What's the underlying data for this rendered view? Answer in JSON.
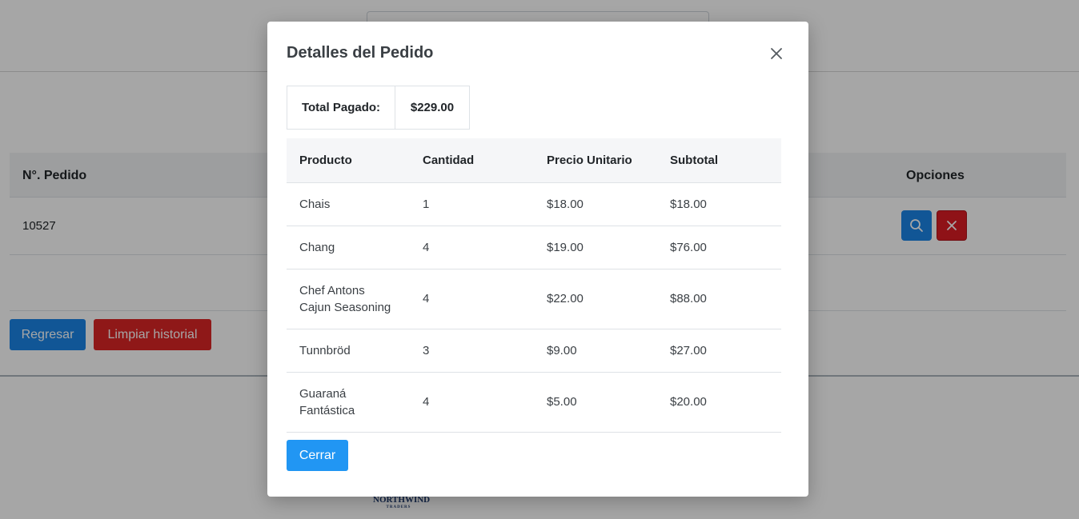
{
  "background": {
    "table": {
      "headers": {
        "order_no": "N°. Pedido",
        "options": "Opciones"
      },
      "rows": [
        {
          "order_no": "10527"
        }
      ]
    },
    "buttons": {
      "back": "Regresar",
      "clear_history": "Limpiar historial"
    },
    "logo": {
      "name": "NORTHWIND",
      "tagline": "TRADERS"
    },
    "colors": {
      "primary": "#1b84e7",
      "danger": "#dc2626"
    }
  },
  "modal": {
    "title": "Detalles del Pedido",
    "total": {
      "label": "Total Pagado:",
      "value": "$229.00"
    },
    "table": {
      "headers": [
        "Producto",
        "Cantidad",
        "Precio Unitario",
        "Subtotal"
      ],
      "rows": [
        {
          "product": "Chais",
          "qty": "1",
          "unit_price": "$18.00",
          "subtotal": "$18.00"
        },
        {
          "product": "Chang",
          "qty": "4",
          "unit_price": "$19.00",
          "subtotal": "$76.00"
        },
        {
          "product": "Chef Antons Cajun Seasoning",
          "qty": "4",
          "unit_price": "$22.00",
          "subtotal": "$88.00"
        },
        {
          "product": "Tunnbröd",
          "qty": "3",
          "unit_price": "$9.00",
          "subtotal": "$27.00"
        },
        {
          "product": "Guaraná Fantástica",
          "qty": "4",
          "unit_price": "$5.00",
          "subtotal": "$20.00"
        }
      ]
    },
    "close_button": "Cerrar",
    "colors": {
      "close_button": "#2196f3"
    }
  }
}
